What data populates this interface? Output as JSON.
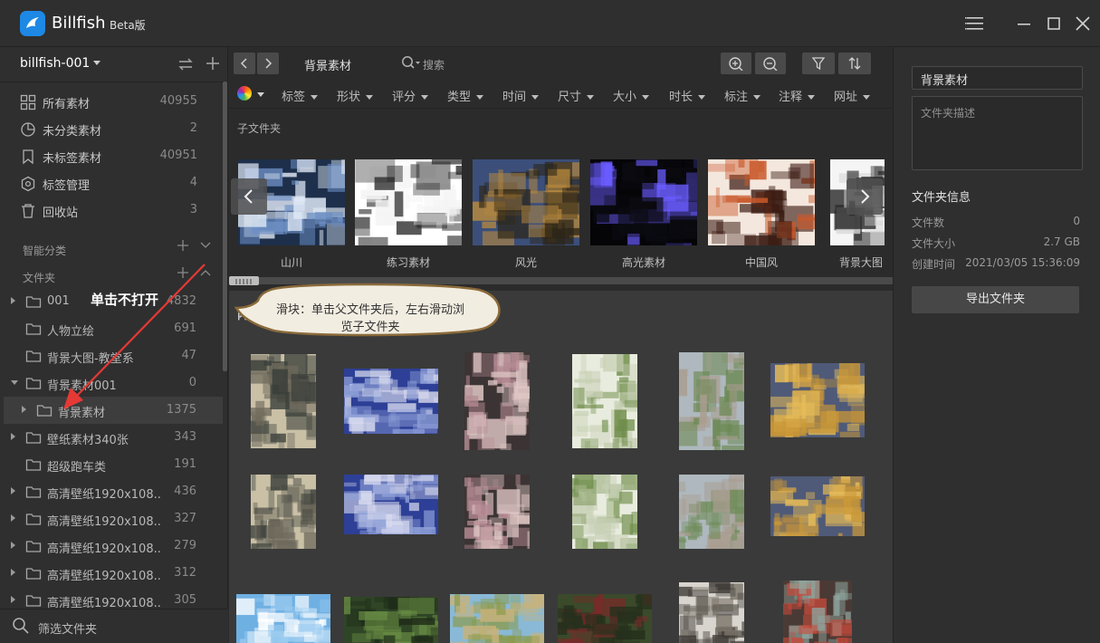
{
  "app": {
    "name": "Billfish",
    "badge": "Beta版"
  },
  "sidebar": {
    "library": "billfish-001",
    "nav": [
      {
        "label": "所有素材",
        "count": "40955",
        "icon": "grid-icon"
      },
      {
        "label": "未分类素材",
        "count": "2",
        "icon": "pie-chart-icon"
      },
      {
        "label": "未标签素材",
        "count": "40951",
        "icon": "untagged-icon"
      },
      {
        "label": "标签管理",
        "count": "4",
        "icon": "tag-icon"
      },
      {
        "label": "回收站",
        "count": "3",
        "icon": "trash-icon"
      }
    ],
    "smart_section": "智能分类",
    "folder_section": "文件夹",
    "folders": [
      {
        "label": "001",
        "count": "4832",
        "expander": "right",
        "indent": 0
      },
      {
        "label": "人物立绘",
        "count": "691",
        "expander": "",
        "indent": 0
      },
      {
        "label": "背景大图-教堂系",
        "count": "47",
        "expander": "",
        "indent": 0
      },
      {
        "label": "背景素材001",
        "count": "0",
        "expander": "down",
        "indent": 0
      },
      {
        "label": "背景素材",
        "count": "1375",
        "expander": "right",
        "indent": 1,
        "selected": true
      },
      {
        "label": "壁纸素材340张",
        "count": "343",
        "expander": "right",
        "indent": 0
      },
      {
        "label": "超级跑车类",
        "count": "191",
        "expander": "",
        "indent": 0
      },
      {
        "label": "高清壁纸1920x108..",
        "count": "436",
        "expander": "right",
        "indent": 0
      },
      {
        "label": "高清壁纸1920x108..",
        "count": "327",
        "expander": "right",
        "indent": 0
      },
      {
        "label": "高清壁纸1920x108..",
        "count": "279",
        "expander": "right",
        "indent": 0
      },
      {
        "label": "高清壁纸1920x108..",
        "count": "312",
        "expander": "right",
        "indent": 0
      },
      {
        "label": "高清壁纸1920x108..",
        "count": "305",
        "expander": "right",
        "indent": 0
      }
    ],
    "filter_placeholder": "筛选文件夹"
  },
  "toolbar": {
    "title": "背景素材",
    "search": "搜索"
  },
  "filters": [
    "标签",
    "形状",
    "评分",
    "类型",
    "时间",
    "尺寸",
    "大小",
    "时长",
    "标注",
    "注释",
    "网址"
  ],
  "subfolders": {
    "heading": "子文件夹",
    "items": [
      {
        "label": "山川",
        "colors": [
          "#1d2f4a",
          "#6d8fc4",
          "#dfe8f5"
        ]
      },
      {
        "label": "练习素材",
        "colors": [
          "#ffffff",
          "#f4f4f4",
          "#2a2a2a"
        ]
      },
      {
        "label": "风光",
        "colors": [
          "#3b4f7a",
          "#b8893d",
          "#2b2416"
        ]
      },
      {
        "label": "高光素材",
        "colors": [
          "#050508",
          "#0b0b12",
          "#6a5cff"
        ]
      },
      {
        "label": "中国风",
        "colors": [
          "#f4e7dd",
          "#c9592b",
          "#3a1a12"
        ]
      },
      {
        "label": "背景大图",
        "colors": [
          "#f5f5f5",
          "#d8d8d8",
          "#2b2b2b"
        ]
      }
    ]
  },
  "content": {
    "label": "内容",
    "thumbs": [
      {
        "colors": [
          "#c9c0a6",
          "#6f6a5c",
          "#3a3f3a"
        ]
      },
      {
        "colors": [
          "#2d3f96",
          "#8fa0d8",
          "#d9dcef"
        ]
      },
      {
        "colors": [
          "#3c3434",
          "#b58a93",
          "#e0c8c6"
        ]
      },
      {
        "colors": [
          "#e8ecde",
          "#6f8d4a",
          "#c7cfb4"
        ]
      },
      {
        "colors": [
          "#aeb8be",
          "#6d8a55",
          "#a99d90"
        ]
      },
      {
        "colors": [
          "#4f5a78",
          "#c89637",
          "#e6bb58"
        ]
      },
      {
        "colors": [
          "#c9c0a6",
          "#6f6a5c",
          "#3a3f3a"
        ]
      },
      {
        "colors": [
          "#2d3f96",
          "#8fa0d8",
          "#d9dcef"
        ]
      },
      {
        "colors": [
          "#3c3434",
          "#b58a93",
          "#e0c8c6"
        ]
      },
      {
        "colors": [
          "#e8ecde",
          "#6f8d4a",
          "#c7cfb4"
        ]
      },
      {
        "colors": [
          "#aeb8be",
          "#6d8a55",
          "#a99d90"
        ]
      },
      {
        "colors": [
          "#4f5a78",
          "#c89637",
          "#e6bb58"
        ]
      },
      {
        "colors": [
          "#6fb0e3",
          "#ffffff",
          "#9ecdf0"
        ]
      },
      {
        "colors": [
          "#2f4526",
          "#6a8e45",
          "#1e2c18"
        ]
      },
      {
        "colors": [
          "#89b9d6",
          "#8a9a4a",
          "#c8b27a"
        ]
      },
      {
        "colors": [
          "#3a4a2a",
          "#7a2a2a",
          "#25301c"
        ]
      },
      {
        "colors": [
          "#d8d4ce",
          "#7a746a",
          "#3e3a36"
        ]
      },
      {
        "colors": [
          "#4a3a35",
          "#8fa7a0",
          "#c64a3a"
        ]
      }
    ]
  },
  "callout": {
    "text": "滑块：单击父文件夹后，左右滑动浏览子文件夹"
  },
  "annotation": {
    "text": "单击不打开"
  },
  "panel": {
    "name": "背景素材",
    "desc_placeholder": "文件夹描述",
    "info_heading": "文件夹信息",
    "rows": [
      {
        "k": "文件数",
        "v": "0"
      },
      {
        "k": "文件大小",
        "v": "2.7 GB"
      },
      {
        "k": "创建时间",
        "v": "2021/03/05 15:36:09"
      }
    ],
    "export_label": "导出文件夹"
  },
  "colors": {
    "accent": "#1e88e5",
    "annotation": "#e53935",
    "callout_bg": "#f2ede1",
    "callout_border": "#8a6a3a"
  }
}
